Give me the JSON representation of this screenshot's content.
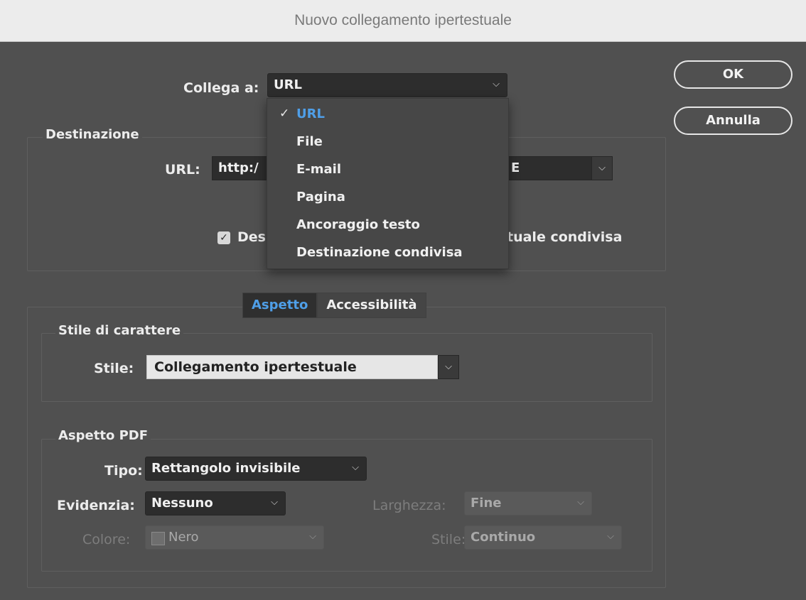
{
  "window": {
    "title": "Nuovo collegamento ipertestuale"
  },
  "link_to": {
    "label": "Collega a:",
    "value": "URL"
  },
  "buttons": {
    "ok": "OK",
    "cancel": "Annulla"
  },
  "destination": {
    "title": "Destinazione",
    "url_label": "URL:",
    "url_value": "http:/",
    "url_tail": "E",
    "checkbox_label_start": "Des",
    "checkbox_label_end": "tuale condivisa",
    "checkbox_checked": true
  },
  "dropdown": {
    "options": [
      "URL",
      "File",
      "E-mail",
      "Pagina",
      "Ancoraggio testo",
      "Destinazione condivisa"
    ],
    "selected": "URL"
  },
  "tabs": [
    "Aspetto",
    "Accessibilità"
  ],
  "char_style": {
    "title": "Stile di carattere",
    "style_label": "Stile:",
    "style_value": "Collegamento ipertestuale"
  },
  "pdf": {
    "title": "Aspetto PDF",
    "type_label": "Tipo:",
    "type_value": "Rettangolo invisibile",
    "highlight_label": "Evidenzia:",
    "highlight_value": "Nessuno",
    "width_label": "Larghezza:",
    "width_value": "Fine",
    "color_label": "Colore:",
    "color_value": "Nero",
    "style_label": "Stile:",
    "style_value": "Continuo"
  },
  "colors": {
    "accent": "#4f9fe8",
    "panel": "#505050",
    "field": "#2d2d2d"
  }
}
